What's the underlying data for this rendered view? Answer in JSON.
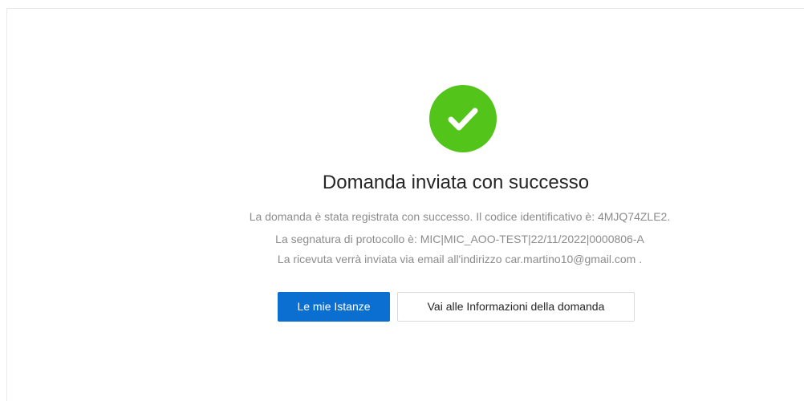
{
  "result": {
    "status_icon": "check-circle-icon",
    "status_color": "#52c41a",
    "title": "Domanda inviata con successo",
    "lines": [
      "La domanda è stata registrata con successo. Il codice identificativo è: 4MJQ74ZLE2.",
      "La segnatura di protocollo è: MIC|MIC_AOO-TEST|22/11/2022|0000806-A",
      "La ricevuta verrà inviata via email all'indirizzo car.martino10@gmail.com ."
    ]
  },
  "actions": {
    "primary_label": "Le mie Istanze",
    "secondary_label": "Vai alle Informazioni della domanda",
    "primary_color": "#0b6fd1"
  }
}
